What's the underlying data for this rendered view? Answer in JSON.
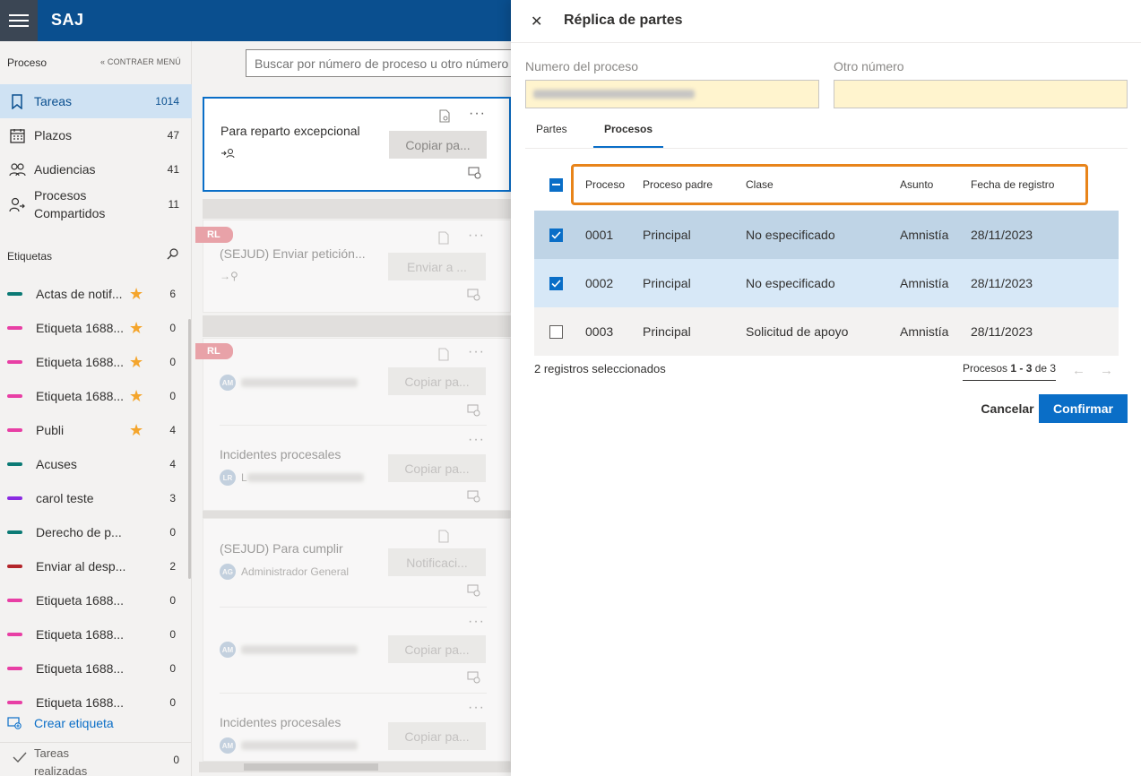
{
  "app": {
    "title": "SAJ"
  },
  "sidebar": {
    "header": "Proceso",
    "collapse_label": "CONTRAER MENÚ",
    "nav": [
      {
        "label": "Tareas",
        "count": "1014",
        "icon": "bookmark-icon"
      },
      {
        "label": "Plazos",
        "count": "47",
        "icon": "calendar-icon"
      },
      {
        "label": "Audiencias",
        "count": "41",
        "icon": "people-icon"
      },
      {
        "label": "Procesos Compartidos",
        "count": "11",
        "icon": "share-person-icon"
      }
    ],
    "tags_header": "Etiquetas",
    "tags": [
      {
        "label": "Actas de notif...",
        "count": "6",
        "color": "#0b7a75",
        "starred": true
      },
      {
        "label": "Etiqueta 1688...",
        "count": "0",
        "color": "#e83fa5",
        "starred": true
      },
      {
        "label": "Etiqueta 1688...",
        "count": "0",
        "color": "#e83fa5",
        "starred": true
      },
      {
        "label": "Etiqueta 1688...",
        "count": "0",
        "color": "#e83fa5",
        "starred": true
      },
      {
        "label": "Publi",
        "count": "4",
        "color": "#e83fa5",
        "starred": true
      },
      {
        "label": "Acuses",
        "count": "4",
        "color": "#0b7a75",
        "starred": false
      },
      {
        "label": "carol teste",
        "count": "3",
        "color": "#8a2be2",
        "starred": false
      },
      {
        "label": "Derecho de p...",
        "count": "0",
        "color": "#0b7a75",
        "starred": false
      },
      {
        "label": "Enviar al desp...",
        "count": "2",
        "color": "#b3262b",
        "starred": false
      },
      {
        "label": "Etiqueta 1688...",
        "count": "0",
        "color": "#e83fa5",
        "starred": false
      },
      {
        "label": "Etiqueta 1688...",
        "count": "0",
        "color": "#e83fa5",
        "starred": false
      },
      {
        "label": "Etiqueta 1688...",
        "count": "0",
        "color": "#e83fa5",
        "starred": false
      },
      {
        "label": "Etiqueta 1688...",
        "count": "0",
        "color": "#e83fa5",
        "starred": false
      }
    ],
    "create_tag": "Crear etiqueta",
    "done": {
      "label": "Tareas realizadas",
      "count": "0"
    }
  },
  "search": {
    "placeholder": "Buscar por número de proceso u otro número"
  },
  "cards": [
    {
      "title": "Para reparto excepcional",
      "button": "Copiar pa..."
    },
    {
      "badge": "RL",
      "title": "(SEJUD) Enviar petición...",
      "button": "Enviar a ..."
    },
    {
      "badge": "RL",
      "avatar": "AM",
      "button": "Copiar pa..."
    },
    {
      "title": "Incidentes procesales",
      "avatar": "LR",
      "sub": "L",
      "button": "Copiar pa..."
    },
    {
      "title": "(SEJUD) Para cumplir",
      "avatar": "AG",
      "sub": "Administrador General",
      "button": "Notificaci..."
    },
    {
      "avatar": "AM",
      "button": "Copiar pa..."
    },
    {
      "title": "Incidentes procesales",
      "avatar": "AM",
      "button": "Copiar pa..."
    }
  ],
  "panel": {
    "title": "Réplica de partes",
    "field1_label": "Numero del proceso",
    "field2_label": "Otro número",
    "tabs": [
      "Partes",
      "Procesos"
    ],
    "columns": [
      "Proceso",
      "Proceso padre",
      "Clase",
      "Asunto",
      "Fecha de registro"
    ],
    "rows": [
      {
        "proceso": "0001",
        "padre": "Principal",
        "clase": "No especificado",
        "asunto": "Amnistía",
        "fecha": "28/11/2023",
        "checked": true
      },
      {
        "proceso": "0002",
        "padre": "Principal",
        "clase": "No especificado",
        "asunto": "Amnistía",
        "fecha": "28/11/2023",
        "checked": true
      },
      {
        "proceso": "0003",
        "padre": "Principal",
        "clase": "Solicitud de apoyo",
        "asunto": "Amnistía",
        "fecha": "28/11/2023",
        "checked": false
      }
    ],
    "selected_text": "2 registros seleccionados",
    "pager": {
      "prefix": "Procesos",
      "range": "1 - 3",
      "of": "de 3"
    },
    "cancel": "Cancelar",
    "confirm": "Confirmar"
  }
}
